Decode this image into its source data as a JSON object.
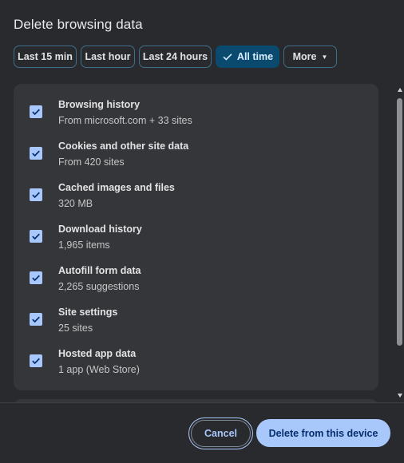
{
  "dialog": {
    "title": "Delete browsing data"
  },
  "time_range": {
    "options": [
      {
        "label": "Last 15 min",
        "selected": false
      },
      {
        "label": "Last hour",
        "selected": false
      },
      {
        "label": "Last 24 hours",
        "selected": false
      },
      {
        "label": "All time",
        "selected": true
      },
      {
        "label": "More",
        "selected": false
      }
    ]
  },
  "data_types": [
    {
      "label": "Browsing history",
      "detail": "From microsoft.com + 33 sites",
      "checked": true
    },
    {
      "label": "Cookies and other site data",
      "detail": "From 420 sites",
      "checked": true
    },
    {
      "label": "Cached images and files",
      "detail": "320 MB",
      "checked": true
    },
    {
      "label": "Download history",
      "detail": "1,965 items",
      "checked": true
    },
    {
      "label": "Autofill form data",
      "detail": "2,265 suggestions",
      "checked": true
    },
    {
      "label": "Site settings",
      "detail": "25 sites",
      "checked": true
    },
    {
      "label": "Hosted app data",
      "detail": "1 app (Web Store)",
      "checked": true
    }
  ],
  "buttons": {
    "cancel": "Cancel",
    "delete": "Delete from this device"
  },
  "colors": {
    "background": "#292a2d",
    "card": "#35363a",
    "accent": "#a8c7fa",
    "selected_chip": "#0b4a6f",
    "chip_border": "#3f6f8a"
  },
  "icons": {
    "check": "check-icon",
    "more_caret": "chevron-down-icon"
  }
}
